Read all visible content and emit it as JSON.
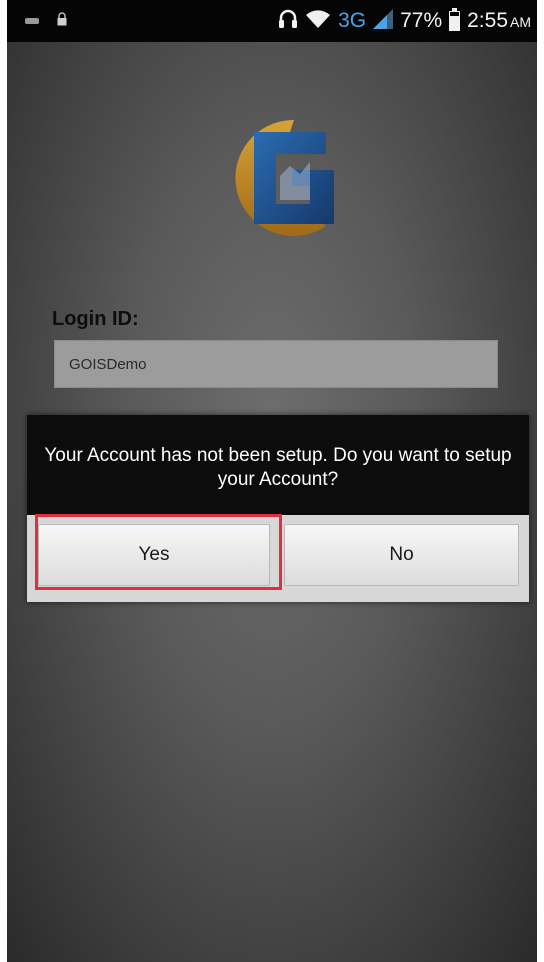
{
  "status_bar": {
    "network_type": "3G",
    "battery_percent": "77%",
    "battery_level": 0.77,
    "time": "2:55",
    "time_suffix": "AM",
    "icons": [
      "notification-icon",
      "lock-icon",
      "headset-icon",
      "wifi-icon",
      "signal-icon",
      "battery-icon"
    ]
  },
  "logo": {
    "name": "app-logo",
    "colors": {
      "gold": "#c8902a",
      "blue": "#1b4b8a"
    }
  },
  "login": {
    "label": "Login ID:",
    "value": "GOISDemo"
  },
  "dialog": {
    "message": "Your Account has not been setup. Do you want to setup your Account?",
    "yes_label": "Yes",
    "no_label": "No"
  },
  "colors": {
    "highlight": "#e0303f",
    "dialog_header": "#0c0c0c",
    "background": "#595959"
  }
}
